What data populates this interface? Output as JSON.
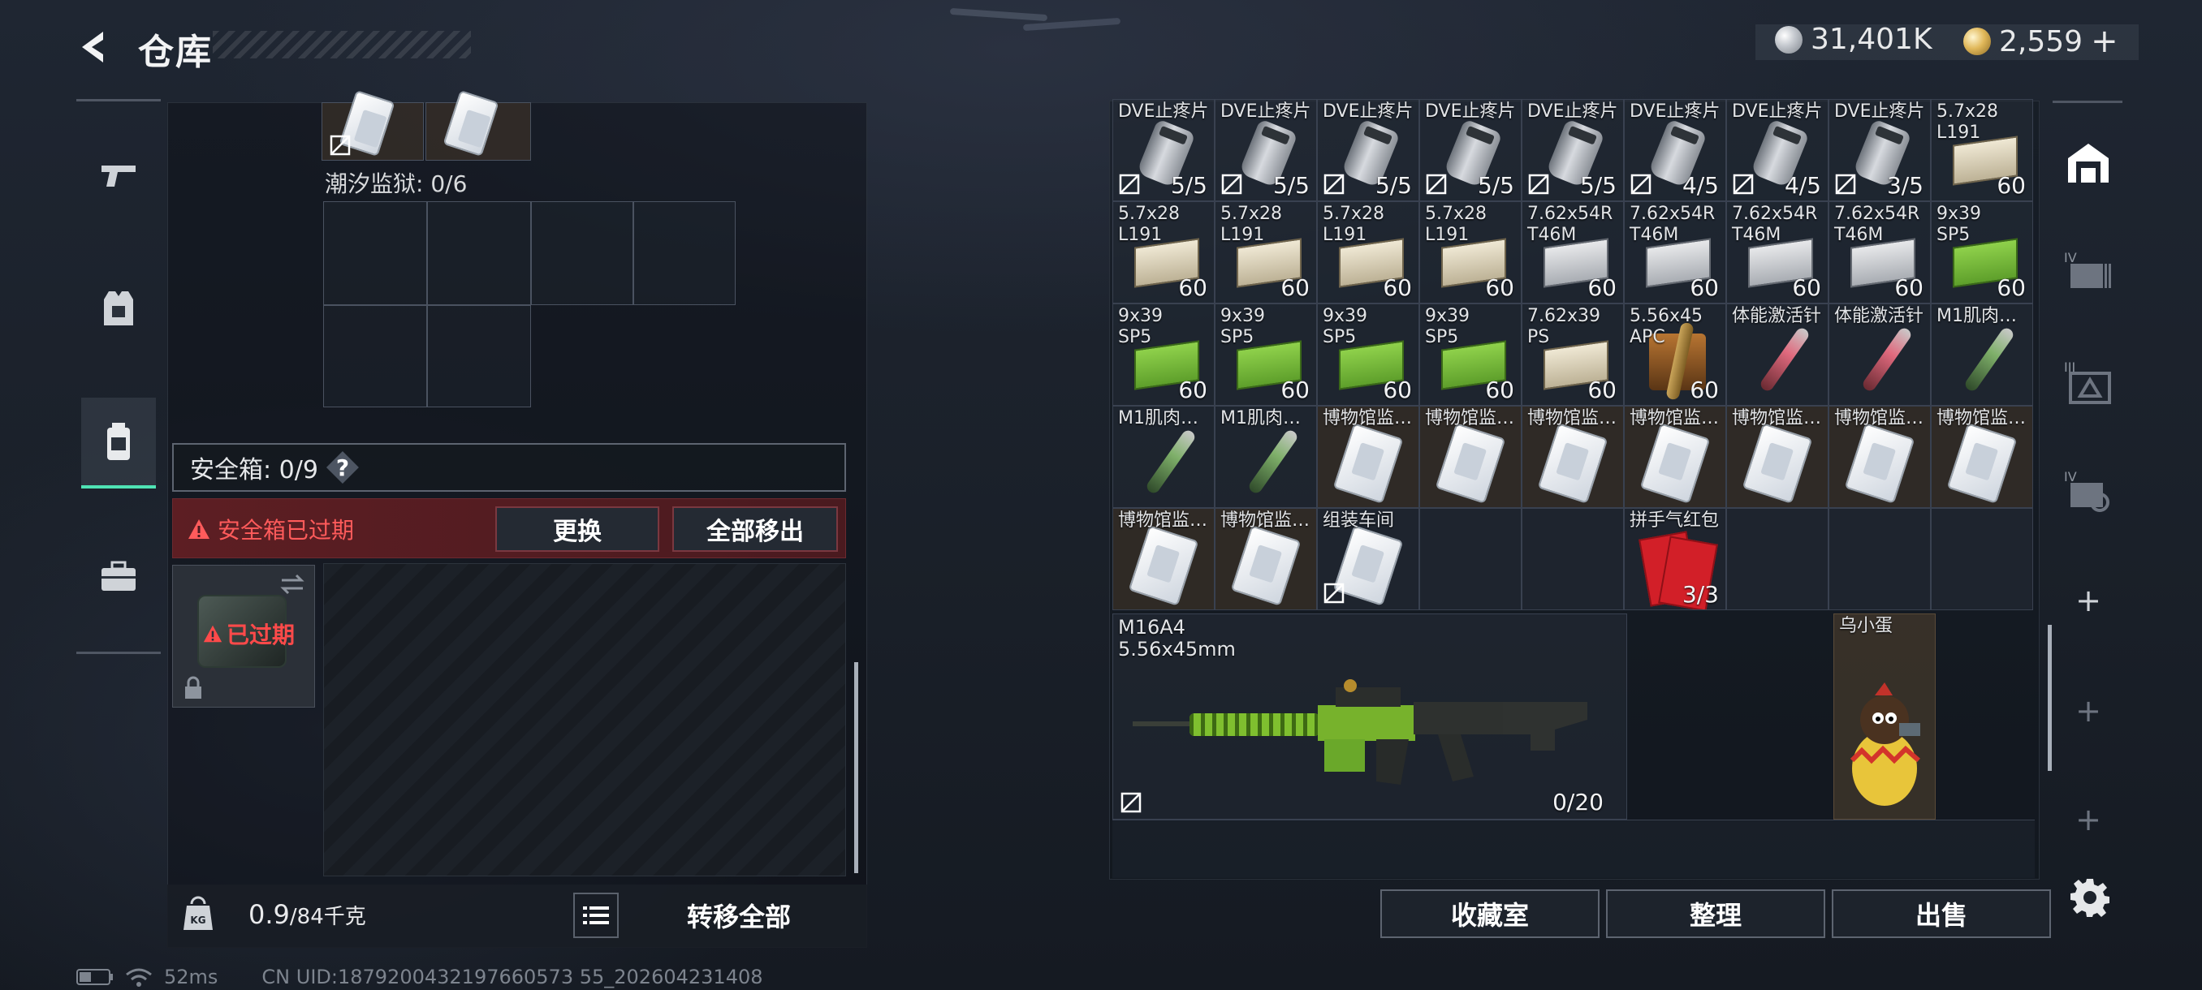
{
  "header": {
    "title": "仓库",
    "currency_silver": "31,401K",
    "currency_gold": "2,559",
    "add_label": "+"
  },
  "left": {
    "prison_label": "潮汐监狱: 0/6",
    "safebox_label": "安全箱: 0/9",
    "help_label": "?",
    "expired_warning": "安全箱已过期",
    "replace_label": "更换",
    "remove_all_label": "全部移出",
    "expired_tag": "已过期",
    "weight_value": "0.9",
    "weight_max": "/84千克",
    "transfer_all_label": "转移全部"
  },
  "stash": {
    "rows": [
      [
        {
          "label": "DVE止疼片",
          "count": "5/5",
          "icon": "vial",
          "lock": true
        },
        {
          "label": "DVE止疼片",
          "count": "5/5",
          "icon": "vial",
          "lock": true
        },
        {
          "label": "DVE止疼片",
          "count": "5/5",
          "icon": "vial",
          "lock": true
        },
        {
          "label": "DVE止疼片",
          "count": "5/5",
          "icon": "vial",
          "lock": true
        },
        {
          "label": "DVE止疼片",
          "count": "5/5",
          "icon": "vial",
          "lock": true
        },
        {
          "label": "DVE止疼片",
          "count": "4/5",
          "icon": "vial",
          "lock": true
        },
        {
          "label": "DVE止疼片",
          "count": "4/5",
          "icon": "vial",
          "lock": true
        },
        {
          "label": "DVE止疼片",
          "count": "3/5",
          "icon": "vial",
          "lock": true
        },
        {
          "label": "5.7x28\nL191",
          "count": "60",
          "icon": "ammo-tan",
          "lock": false
        }
      ],
      [
        {
          "label": "5.7x28\nL191",
          "count": "60",
          "icon": "ammo-tan",
          "lock": false
        },
        {
          "label": "5.7x28\nL191",
          "count": "60",
          "icon": "ammo-tan",
          "lock": false
        },
        {
          "label": "5.7x28\nL191",
          "count": "60",
          "icon": "ammo-tan",
          "lock": false
        },
        {
          "label": "5.7x28\nL191",
          "count": "60",
          "icon": "ammo-tan",
          "lock": false
        },
        {
          "label": "7.62x54R\nT46M",
          "count": "60",
          "icon": "ammo-grey",
          "lock": false
        },
        {
          "label": "7.62x54R\nT46M",
          "count": "60",
          "icon": "ammo-grey",
          "lock": false
        },
        {
          "label": "7.62x54R\nT46M",
          "count": "60",
          "icon": "ammo-grey",
          "lock": false
        },
        {
          "label": "7.62x54R\nT46M",
          "count": "60",
          "icon": "ammo-grey",
          "lock": false
        },
        {
          "label": "9x39\nSP5",
          "count": "60",
          "icon": "ammo-green",
          "lock": false
        }
      ],
      [
        {
          "label": "9x39\nSP5",
          "count": "60",
          "icon": "ammo-green",
          "lock": false
        },
        {
          "label": "9x39\nSP5",
          "count": "60",
          "icon": "ammo-green",
          "lock": false
        },
        {
          "label": "9x39\nSP5",
          "count": "60",
          "icon": "ammo-green",
          "lock": false
        },
        {
          "label": "9x39\nSP5",
          "count": "60",
          "icon": "ammo-green",
          "lock": false
        },
        {
          "label": "7.62x39\nPS",
          "count": "60",
          "icon": "ammo-tan",
          "lock": false
        },
        {
          "label": "5.56x45\nAPC",
          "count": "60",
          "icon": "bullet",
          "lock": false
        },
        {
          "label": "体能激活针",
          "count": "",
          "icon": "syringe-red",
          "lock": false
        },
        {
          "label": "体能激活针",
          "count": "",
          "icon": "syringe-red",
          "lock": false
        },
        {
          "label": "M1肌肉…",
          "count": "",
          "icon": "syringe-green",
          "lock": false
        }
      ],
      [
        {
          "label": "M1肌肉…",
          "count": "",
          "icon": "syringe-green",
          "lock": false
        },
        {
          "label": "M1肌肉…",
          "count": "",
          "icon": "syringe-green",
          "lock": false
        },
        {
          "label": "博物馆监…",
          "count": "",
          "icon": "card",
          "lock": false,
          "r1": true
        },
        {
          "label": "博物馆监…",
          "count": "",
          "icon": "card",
          "lock": false,
          "r1": true
        },
        {
          "label": "博物馆监…",
          "count": "",
          "icon": "card",
          "lock": false,
          "r1": true
        },
        {
          "label": "博物馆监…",
          "count": "",
          "icon": "card",
          "lock": false,
          "r1": true
        },
        {
          "label": "博物馆监…",
          "count": "",
          "icon": "card",
          "lock": false,
          "r1": true
        },
        {
          "label": "博物馆监…",
          "count": "",
          "icon": "card",
          "lock": false,
          "r1": true
        },
        {
          "label": "博物馆监…",
          "count": "",
          "icon": "card",
          "lock": false,
          "r1": true
        }
      ],
      [
        {
          "label": "博物馆监…",
          "count": "",
          "icon": "card",
          "lock": false,
          "r1": true
        },
        {
          "label": "博物馆监…",
          "count": "",
          "icon": "card",
          "lock": false,
          "r1": true
        },
        {
          "label": "组装车间",
          "count": "",
          "icon": "card",
          "lock": true
        },
        {
          "label": "",
          "count": "",
          "icon": "",
          "lock": false
        },
        {
          "label": "",
          "count": "",
          "icon": "",
          "lock": false
        },
        {
          "label": "拼手气红包",
          "count": "3/3",
          "icon": "redpack",
          "lock": false
        },
        {
          "label": "",
          "count": "",
          "icon": "",
          "lock": false
        },
        {
          "label": "",
          "count": "",
          "icon": "",
          "lock": false
        },
        {
          "label": "",
          "count": "",
          "icon": "",
          "lock": false
        }
      ]
    ],
    "weapon": {
      "name": "M16A4",
      "caliber": "5.56x45mm",
      "ammo": "0/20"
    },
    "pet": {
      "name": "乌小蛋"
    },
    "buttons": {
      "collection": "收藏室",
      "sort": "整理",
      "sell": "出售"
    }
  },
  "status": {
    "ping": "52ms",
    "uid": "CN UID:1879200432197660573 55_202604231408"
  }
}
